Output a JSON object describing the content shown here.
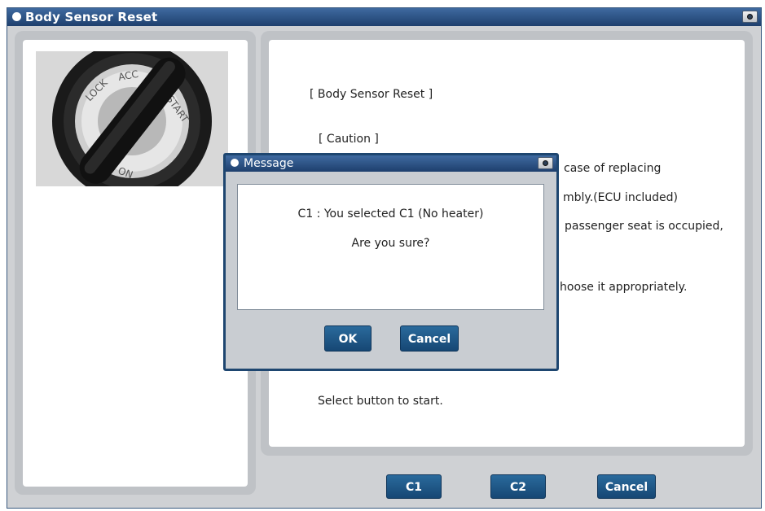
{
  "window": {
    "title": "Body Sensor Reset"
  },
  "content": {
    "heading": "[ Body Sensor Reset ]",
    "caution": "[ Caution ]",
    "line1": "case of replacing",
    "line2": "mbly.(ECU included)",
    "line3": "passenger seat is occupied,",
    "line4": "hoose it appropriately.",
    "instruction": "Select button to start."
  },
  "buttons": {
    "c1": "C1",
    "c2": "C2",
    "cancel": "Cancel"
  },
  "dialog": {
    "title": "Message",
    "message_line1": "C1 : You selected C1 (No heater)",
    "message_line2": "Are you sure?",
    "ok": "OK",
    "cancel": "Cancel"
  },
  "image": {
    "description_icon": "ignition-switch-photo",
    "key_labels": [
      "LOCK",
      "ACC",
      "START",
      "ON"
    ]
  }
}
